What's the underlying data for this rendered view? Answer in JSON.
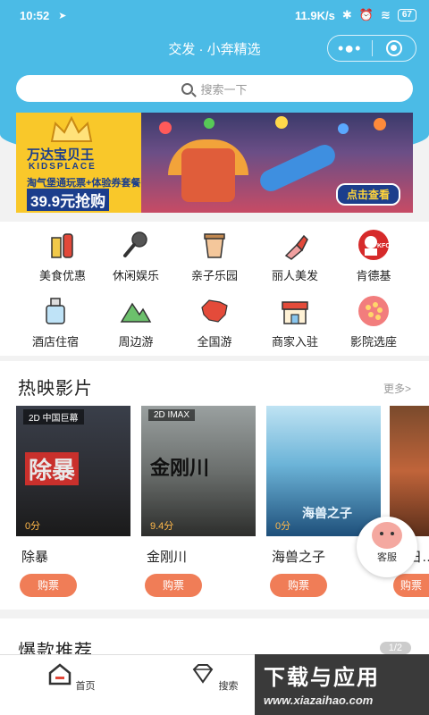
{
  "status_bar": {
    "time": "10:52",
    "network_speed": "11.9K/s",
    "battery": "67"
  },
  "navbar": {
    "title": "交发 · 小奔精选"
  },
  "search": {
    "placeholder": "搜索一下"
  },
  "banner": {
    "brand_cn": "万达宝贝王",
    "brand_en": "KIDSPLACE",
    "subtitle": "淘气堡通玩票+体验券套餐",
    "price": "39.9元抢购",
    "cta": "点击查看"
  },
  "categories": [
    {
      "label": "美食优惠",
      "icon": "food-drink-icon"
    },
    {
      "label": "休闲娱乐",
      "icon": "microphone-icon"
    },
    {
      "label": "亲子乐园",
      "icon": "bubble-tea-icon"
    },
    {
      "label": "丽人美发",
      "icon": "lipstick-icon"
    },
    {
      "label": "肯德基",
      "icon": "kfc-logo-icon"
    },
    {
      "label": "酒店住宿",
      "icon": "hotel-bottle-icon"
    },
    {
      "label": "周边游",
      "icon": "mountain-icon"
    },
    {
      "label": "全国游",
      "icon": "china-map-icon"
    },
    {
      "label": "商家入驻",
      "icon": "storefront-icon"
    },
    {
      "label": "影院选座",
      "icon": "popcorn-icon"
    }
  ],
  "movies_section": {
    "title": "热映影片",
    "more": "更多>",
    "movies": [
      {
        "name": "除暴",
        "tag": "2D 中国巨幕",
        "score": "0分",
        "poster_title": "除暴",
        "buy": "购票"
      },
      {
        "name": "金刚川",
        "tag": "2D IMAX",
        "score": "9.4分",
        "poster_title": "金刚川",
        "buy": "购票"
      },
      {
        "name": "海兽之子",
        "tag": "",
        "score": "0分",
        "poster_title": "海兽之子",
        "buy": "购票"
      },
      {
        "name": "末日…",
        "tag": "",
        "score": "",
        "poster_title": "",
        "buy": "购票"
      }
    ]
  },
  "service": {
    "label": "客服"
  },
  "hot_section": {
    "title": "爆款推荐",
    "page": "1/2"
  },
  "tabbar": {
    "home": "首页",
    "search": "搜索"
  },
  "watermark": {
    "line1": "下载与应用",
    "line2": "www.xiazaihao.com"
  },
  "colors": {
    "primary": "#4bbbe6",
    "buy_button": "#f07d57",
    "banner_bg": "#f9c82a"
  }
}
